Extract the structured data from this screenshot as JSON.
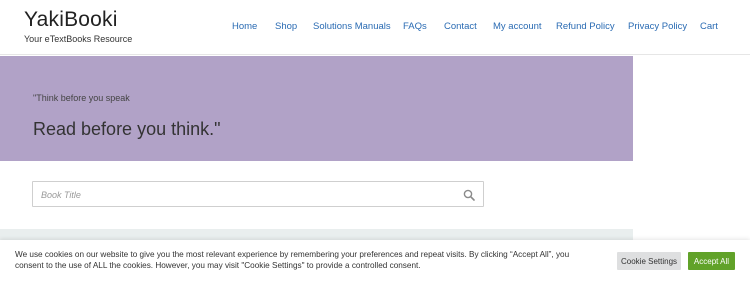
{
  "site": {
    "title": "YakiBooki",
    "tagline": "Your eTextBooks Resource"
  },
  "nav": {
    "items": [
      "Home",
      "Shop",
      "Solutions Manuals",
      "FAQs",
      "Contact",
      "My account",
      "Refund Policy",
      "Privacy Policy",
      "Cart"
    ]
  },
  "hero": {
    "quote_line1": "\"Think before you speak",
    "quote_line2": "Read before you think.\"",
    "background": "#b1a2c7"
  },
  "search": {
    "placeholder": "Book Title",
    "icon": "search-icon"
  },
  "cookie": {
    "text": "We use cookies on our website to give you the most relevant experience by remembering your preferences and repeat visits. By clicking “Accept All”, you consent to the use of ALL the cookies. However, you may visit \"Cookie Settings\" to provide a controlled consent.",
    "settings_label": "Cookie Settings",
    "accept_label": "Accept All",
    "accept_color": "#61a229"
  },
  "colors": {
    "link": "#2a6bb3"
  }
}
